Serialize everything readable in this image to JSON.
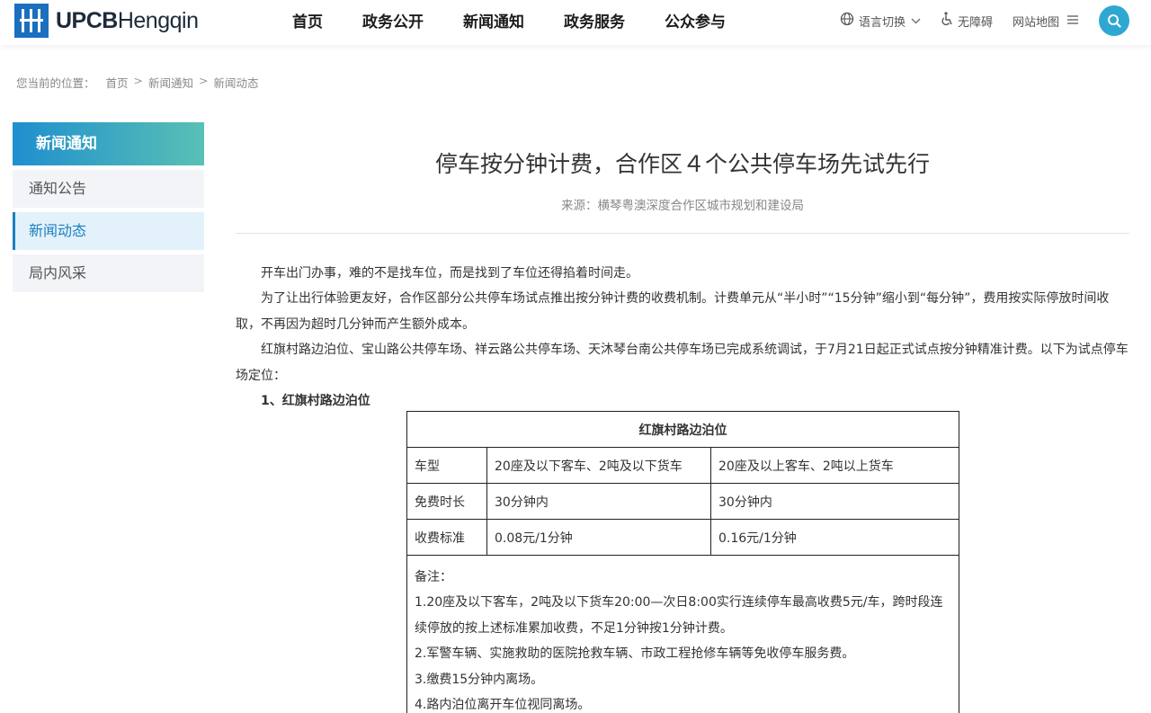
{
  "header": {
    "logo": {
      "bold": "UPCB",
      "light": "Hengqin"
    },
    "nav": [
      "首页",
      "政务公开",
      "新闻通知",
      "政务服务",
      "公众参与"
    ],
    "tools": {
      "language": "语言切换",
      "accessibility": "无障碍",
      "sitemap": "网站地图"
    }
  },
  "breadcrumb": {
    "label": "您当前的位置：",
    "items": [
      "首页",
      "新闻通知",
      "新闻动态"
    ],
    "separator": ">"
  },
  "sidebar": {
    "title": "新闻通知",
    "items": [
      "通知公告",
      "新闻动态",
      "局内风采"
    ],
    "active_index": 1
  },
  "article": {
    "title": "停车按分钟计费，合作区４个公共停车场先试先行",
    "source": "来源：横琴粤澳深度合作区城市规划和建设局",
    "paragraphs": [
      "开车出门办事，难的不是找车位，而是找到了车位还得掐着时间走。",
      "为了让出行体验更友好，合作区部分公共停车场试点推出按分钟计费的收费机制。计费单元从“半小时”“15分钟”缩小到“每分钟”，费用按实际停放时间收取，不再因为超时几分钟而产生额外成本。",
      "红旗村路边泊位、宝山路公共停车场、祥云路公共停车场、天沐琴台南公共停车场已完成系统调试，于7月21日起正式试点按分钟精准计费。以下为试点停车场定位："
    ],
    "subheading": "1、红旗村路边泊位"
  },
  "table": {
    "title": "红旗村路边泊位",
    "rows": [
      [
        "车型",
        "20座及以下客车、2吨及以下货车",
        "20座及以上客车、2吨以上货车"
      ],
      [
        "免费时长",
        "30分钟内",
        "30分钟内"
      ],
      [
        "收费标准",
        "0.08元/1分钟",
        "0.16元/1分钟"
      ]
    ],
    "notes": [
      "备注：",
      "1.20座及以下客车，2吨及以下货车20:00—次日8:00实行连续停车最高收费5元/车，跨时段连续停放的按上述标准累加收费，不足1分钟按1分钟计费。",
      "2.军警车辆、实施救助的医院抢救车辆、市政工程抢修车辆等免收停车服务费。",
      "3.缴费15分钟内离场。",
      "4.路内泊位离开车位视同离场。"
    ]
  },
  "colors": {
    "accent": "#1b7fc2",
    "gradient_start": "#1f8fcf",
    "gradient_end": "#59c0b4",
    "search": "#2fa7d3"
  }
}
